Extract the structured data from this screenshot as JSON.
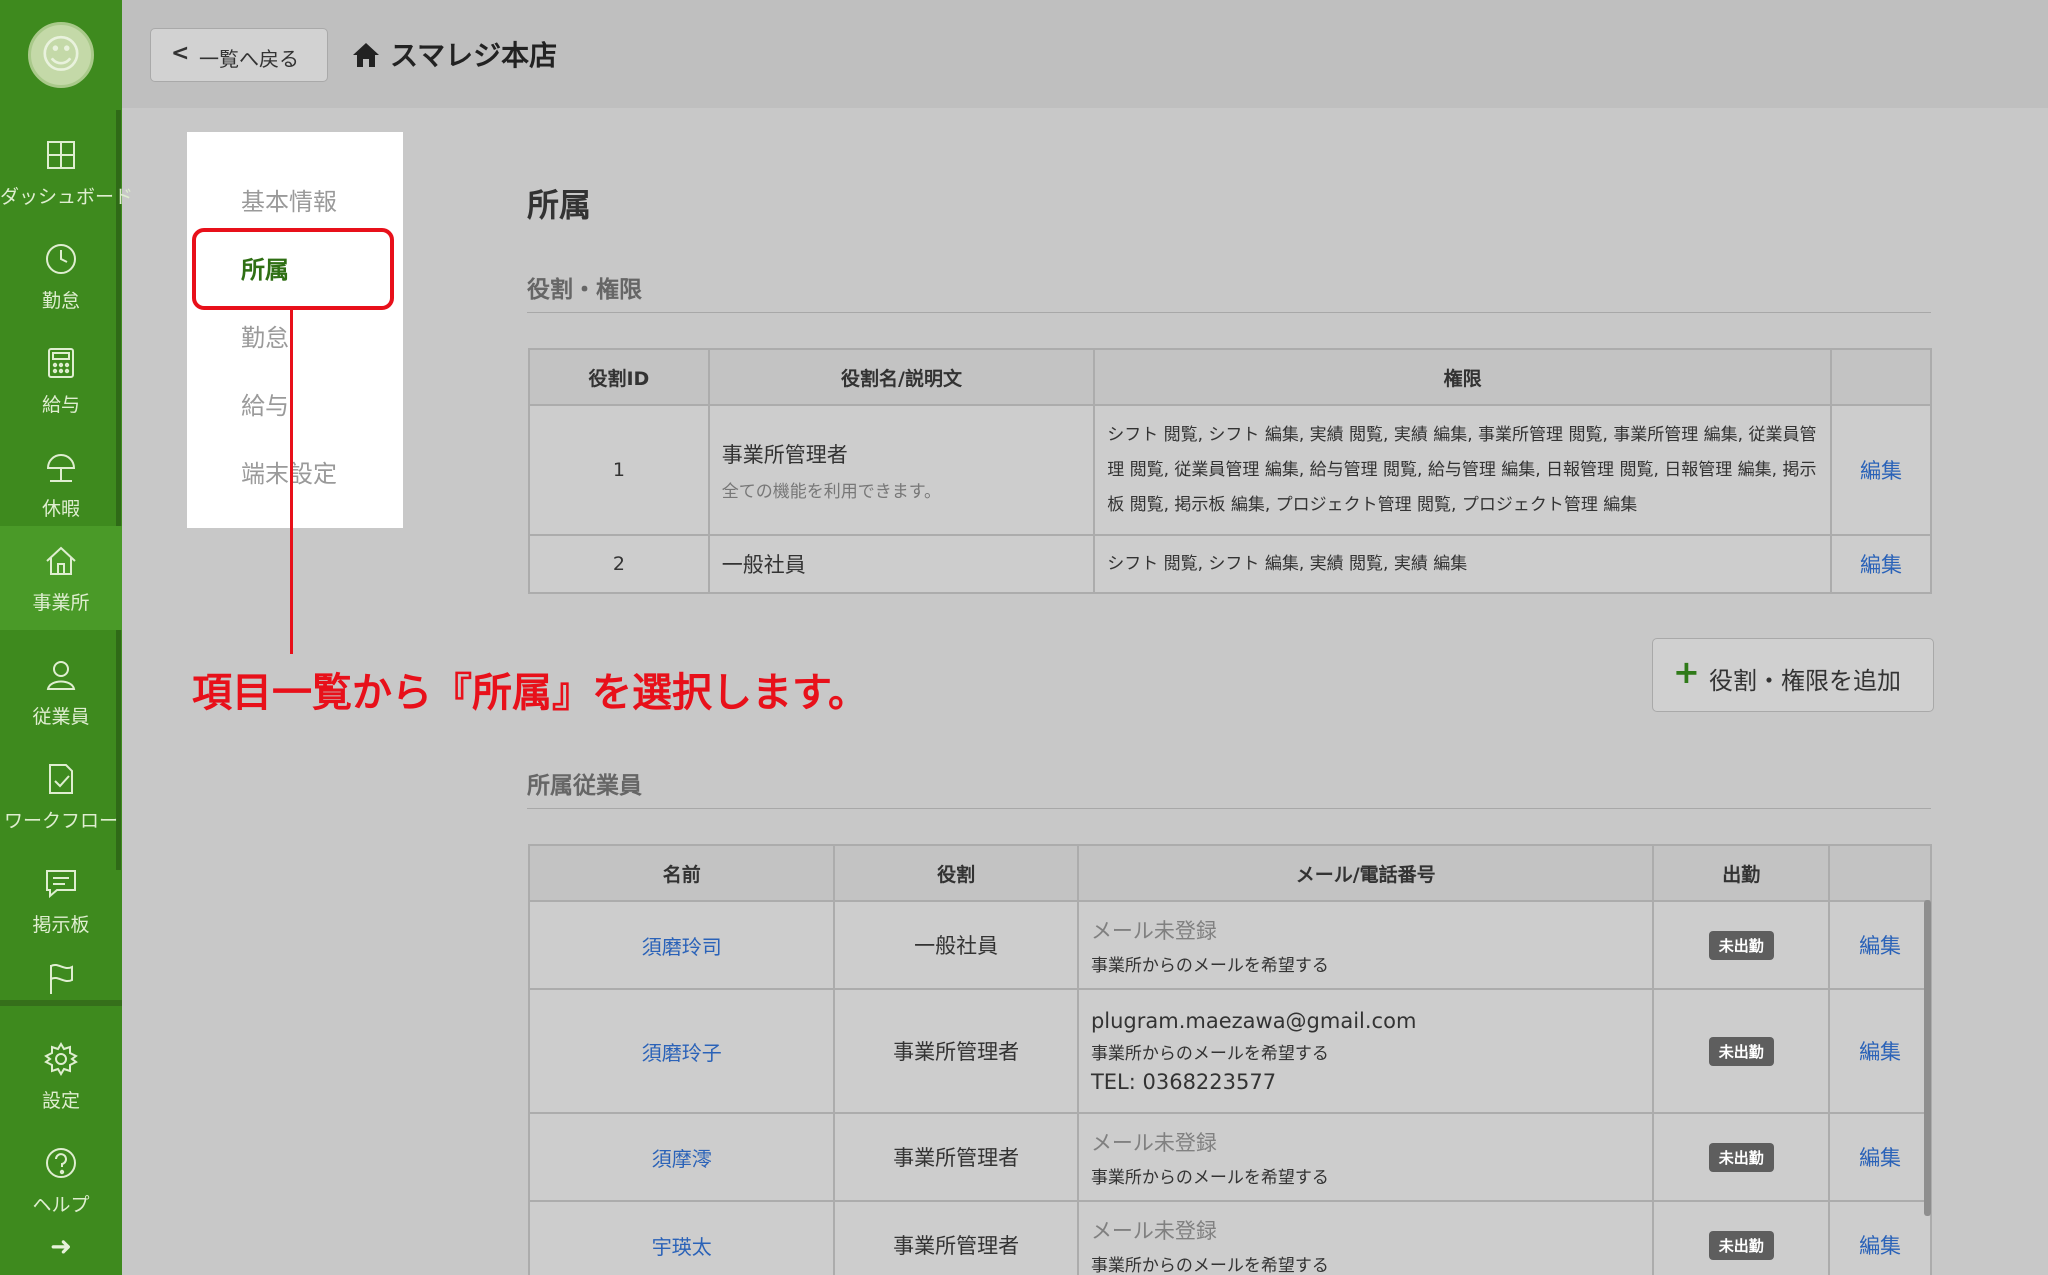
{
  "sidebar": {
    "avatar_icon": "smiley-icon",
    "items": [
      {
        "label": "ダッシュボード",
        "icon": "dashboard-icon"
      },
      {
        "label": "勤怠",
        "icon": "clock-icon"
      },
      {
        "label": "給与",
        "icon": "calculator-icon"
      },
      {
        "label": "休暇",
        "icon": "umbrella-icon"
      },
      {
        "label": "事業所",
        "icon": "home-icon",
        "active": true
      },
      {
        "label": "従業員",
        "icon": "person-icon"
      },
      {
        "label": "ワークフロー",
        "icon": "document-check-icon"
      },
      {
        "label": "掲示板",
        "icon": "chat-icon"
      },
      {
        "label": "",
        "icon": "flag-icon"
      },
      {
        "label": "設定",
        "icon": "gear-icon"
      },
      {
        "label": "ヘルプ",
        "icon": "help-icon"
      }
    ],
    "expand_icon": "arrow-right-icon"
  },
  "topbar": {
    "back_label": "一覧へ戻る",
    "store_name": "スマレジ本店"
  },
  "subnav": {
    "items": [
      "基本情報",
      "所属",
      "勤怠",
      "給与",
      "端末設定"
    ],
    "active_index": 1
  },
  "annotation": {
    "callout": "項目一覧から『所属』を選択します。",
    "color": "#e8101a"
  },
  "main": {
    "title": "所属",
    "roles_section": {
      "title": "役割・権限",
      "headers": [
        "役割ID",
        "役割名/説明文",
        "権限",
        ""
      ],
      "rows": [
        {
          "id": "1",
          "name": "事業所管理者",
          "description": "全ての機能を利用できます。",
          "permissions": "シフト 閲覧, シフト 編集, 実績 閲覧, 実績 編集, 事業所管理 閲覧, 事業所管理 編集, 従業員管理 閲覧, 従業員管理 編集, 給与管理 閲覧, 給与管理 編集, 日報管理 閲覧, 日報管理 編集, 掲示板 閲覧, 掲示板 編集, プロジェクト管理 閲覧, プロジェクト管理 編集",
          "action": "編集"
        },
        {
          "id": "2",
          "name": "一般社員",
          "description": "",
          "permissions": "シフト 閲覧, シフト 編集, 実績 閲覧, 実績 編集",
          "action": "編集"
        }
      ],
      "add_button": "役割・権限を追加"
    },
    "employees_section": {
      "title": "所属従業員",
      "headers": [
        "名前",
        "役割",
        "メール/電話番号",
        "出勤",
        ""
      ],
      "rows": [
        {
          "name": "須磨玲司",
          "role": "一般社員",
          "mail": "メール未登録",
          "mail_registered": false,
          "mail_pref": "事業所からのメールを希望する",
          "tel": "",
          "status": "未出勤",
          "action": "編集"
        },
        {
          "name": "須磨玲子",
          "role": "事業所管理者",
          "mail": "plugram.maezawa@gmail.com",
          "mail_registered": true,
          "mail_pref": "事業所からのメールを希望する",
          "tel": "TEL: 0368223577",
          "status": "未出勤",
          "action": "編集"
        },
        {
          "name": "須摩澪",
          "role": "事業所管理者",
          "mail": "メール未登録",
          "mail_registered": false,
          "mail_pref": "事業所からのメールを希望する",
          "tel": "",
          "status": "未出勤",
          "action": "編集"
        },
        {
          "name": "宇瑛太",
          "role": "事業所管理者",
          "mail": "メール未登録",
          "mail_registered": false,
          "mail_pref": "事業所からのメールを希望する",
          "tel": "",
          "status": "未出勤",
          "action": "編集"
        }
      ]
    }
  }
}
